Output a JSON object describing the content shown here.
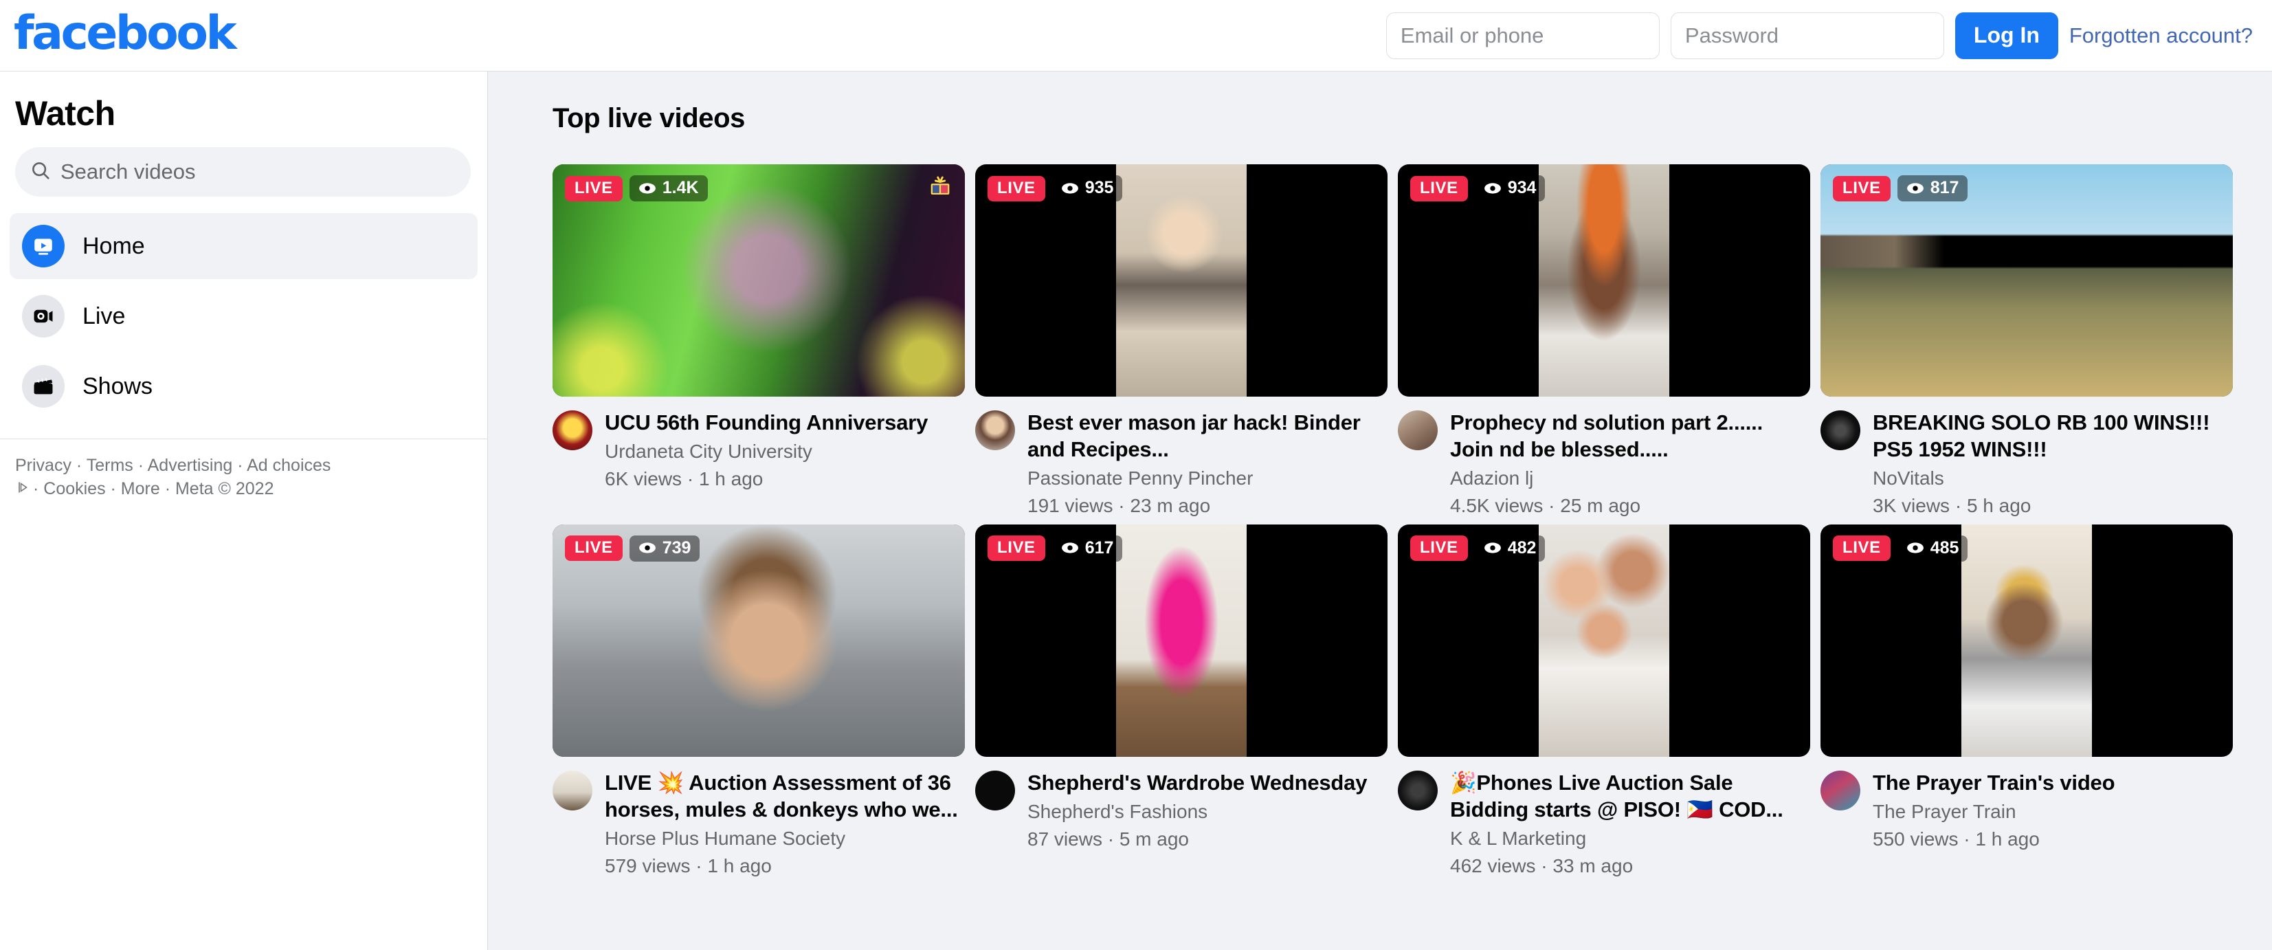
{
  "header": {
    "logo_text": "facebook",
    "logo_color": "#1877f2",
    "email_placeholder": "Email or phone",
    "email_value": "",
    "password_placeholder": "Password",
    "password_value": "",
    "login_label": "Log In",
    "forgot_label": "Forgotten account?"
  },
  "sidebar": {
    "title": "Watch",
    "search_placeholder": "Search videos",
    "search_value": "",
    "items": [
      {
        "label": "Home",
        "icon": "watch-home-icon",
        "active": true
      },
      {
        "label": "Live",
        "icon": "video-camera-icon",
        "active": false
      },
      {
        "label": "Shows",
        "icon": "clapperboard-icon",
        "active": false
      }
    ],
    "footer": {
      "line1": "Privacy · Terms · Advertising · Ad choices",
      "line2": "· Cookies · More · Meta © 2022",
      "links": [
        "Privacy",
        "Terms",
        "Advertising",
        "Ad choices",
        "Cookies",
        "More"
      ],
      "copyright": "Meta © 2022"
    }
  },
  "main": {
    "section_title": "Top live videos",
    "live_badge_label": "LIVE",
    "live_badge_color": "#f02849",
    "videos": [
      {
        "title": "UCU 56th Founding Anniversary",
        "page": "Urdaneta City University",
        "views": "6K views",
        "time": "1 h ago",
        "live_viewers": "1.4K",
        "orientation": "landscape",
        "has_gift_badge": true
      },
      {
        "title": "Best ever mason jar hack! Binder and Recipes...",
        "page": "Passionate Penny Pincher",
        "views": "191 views",
        "time": "23 m ago",
        "live_viewers": "935",
        "orientation": "portrait",
        "has_gift_badge": false
      },
      {
        "title": "Prophecy nd solution part 2...... Join nd be blessed.....",
        "page": "Adazion lj",
        "views": "4.5K views",
        "time": "25 m ago",
        "live_viewers": "934",
        "orientation": "portrait",
        "has_gift_badge": false
      },
      {
        "title": "BREAKING SOLO RB 100 WINS!!! PS5 1952 WINS!!!",
        "page": "NoVitals",
        "views": "3K views",
        "time": "5 h ago",
        "live_viewers": "817",
        "orientation": "landscape",
        "has_gift_badge": false
      },
      {
        "title": "LIVE 💥 Auction Assessment of 36 horses, mules & donkeys who we...",
        "page": "Horse Plus Humane Society",
        "views": "579 views",
        "time": "1 h ago",
        "live_viewers": "739",
        "orientation": "landscape",
        "has_gift_badge": false
      },
      {
        "title": "Shepherd's Wardrobe Wednesday",
        "page": "Shepherd's Fashions",
        "views": "87 views",
        "time": "5 m ago",
        "live_viewers": "617",
        "orientation": "portrait",
        "has_gift_badge": false
      },
      {
        "title": "🎉Phones Live Auction Sale Bidding starts @ PISO! 🇵🇭 COD...",
        "page": "K & L Marketing",
        "views": "462 views",
        "time": "33 m ago",
        "live_viewers": "482",
        "orientation": "portrait",
        "has_gift_badge": false
      },
      {
        "title": "The Prayer Train's video",
        "page": "The Prayer Train",
        "views": "550 views",
        "time": "1 h ago",
        "live_viewers": "485",
        "orientation": "portrait",
        "has_gift_badge": false
      }
    ]
  }
}
